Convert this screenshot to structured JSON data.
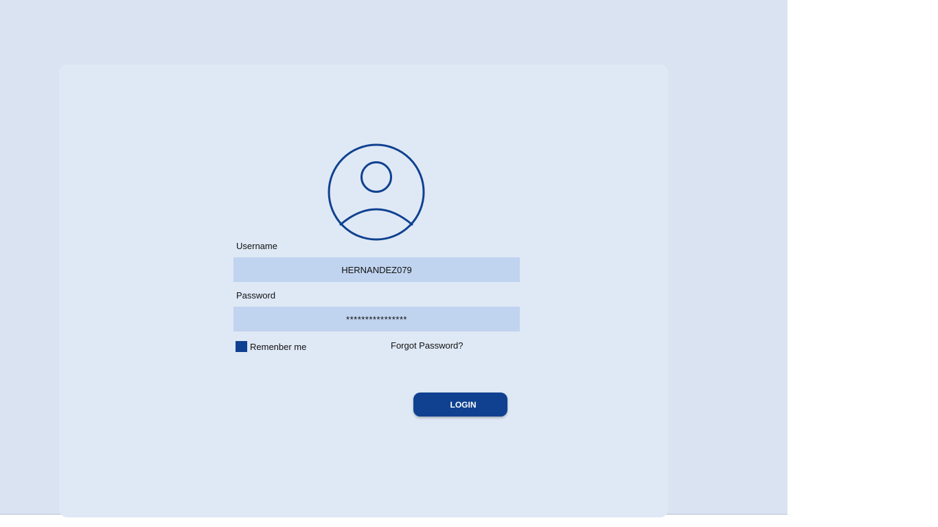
{
  "login_form": {
    "username_label": "Username",
    "username_value": "HERNANDEZ079",
    "password_label": "Password",
    "password_value": "****************",
    "remember_label": "Remenber me",
    "remember_checked": true,
    "forgot_label": "Forgot Password?",
    "login_label": "LOGIN"
  },
  "icons": {
    "avatar": "user-circle-icon"
  },
  "colors": {
    "page_background": "#d9e3f1",
    "card_background": "#dfe8f5",
    "field_background": "#c0d3ef",
    "accent": "#0f4190"
  }
}
